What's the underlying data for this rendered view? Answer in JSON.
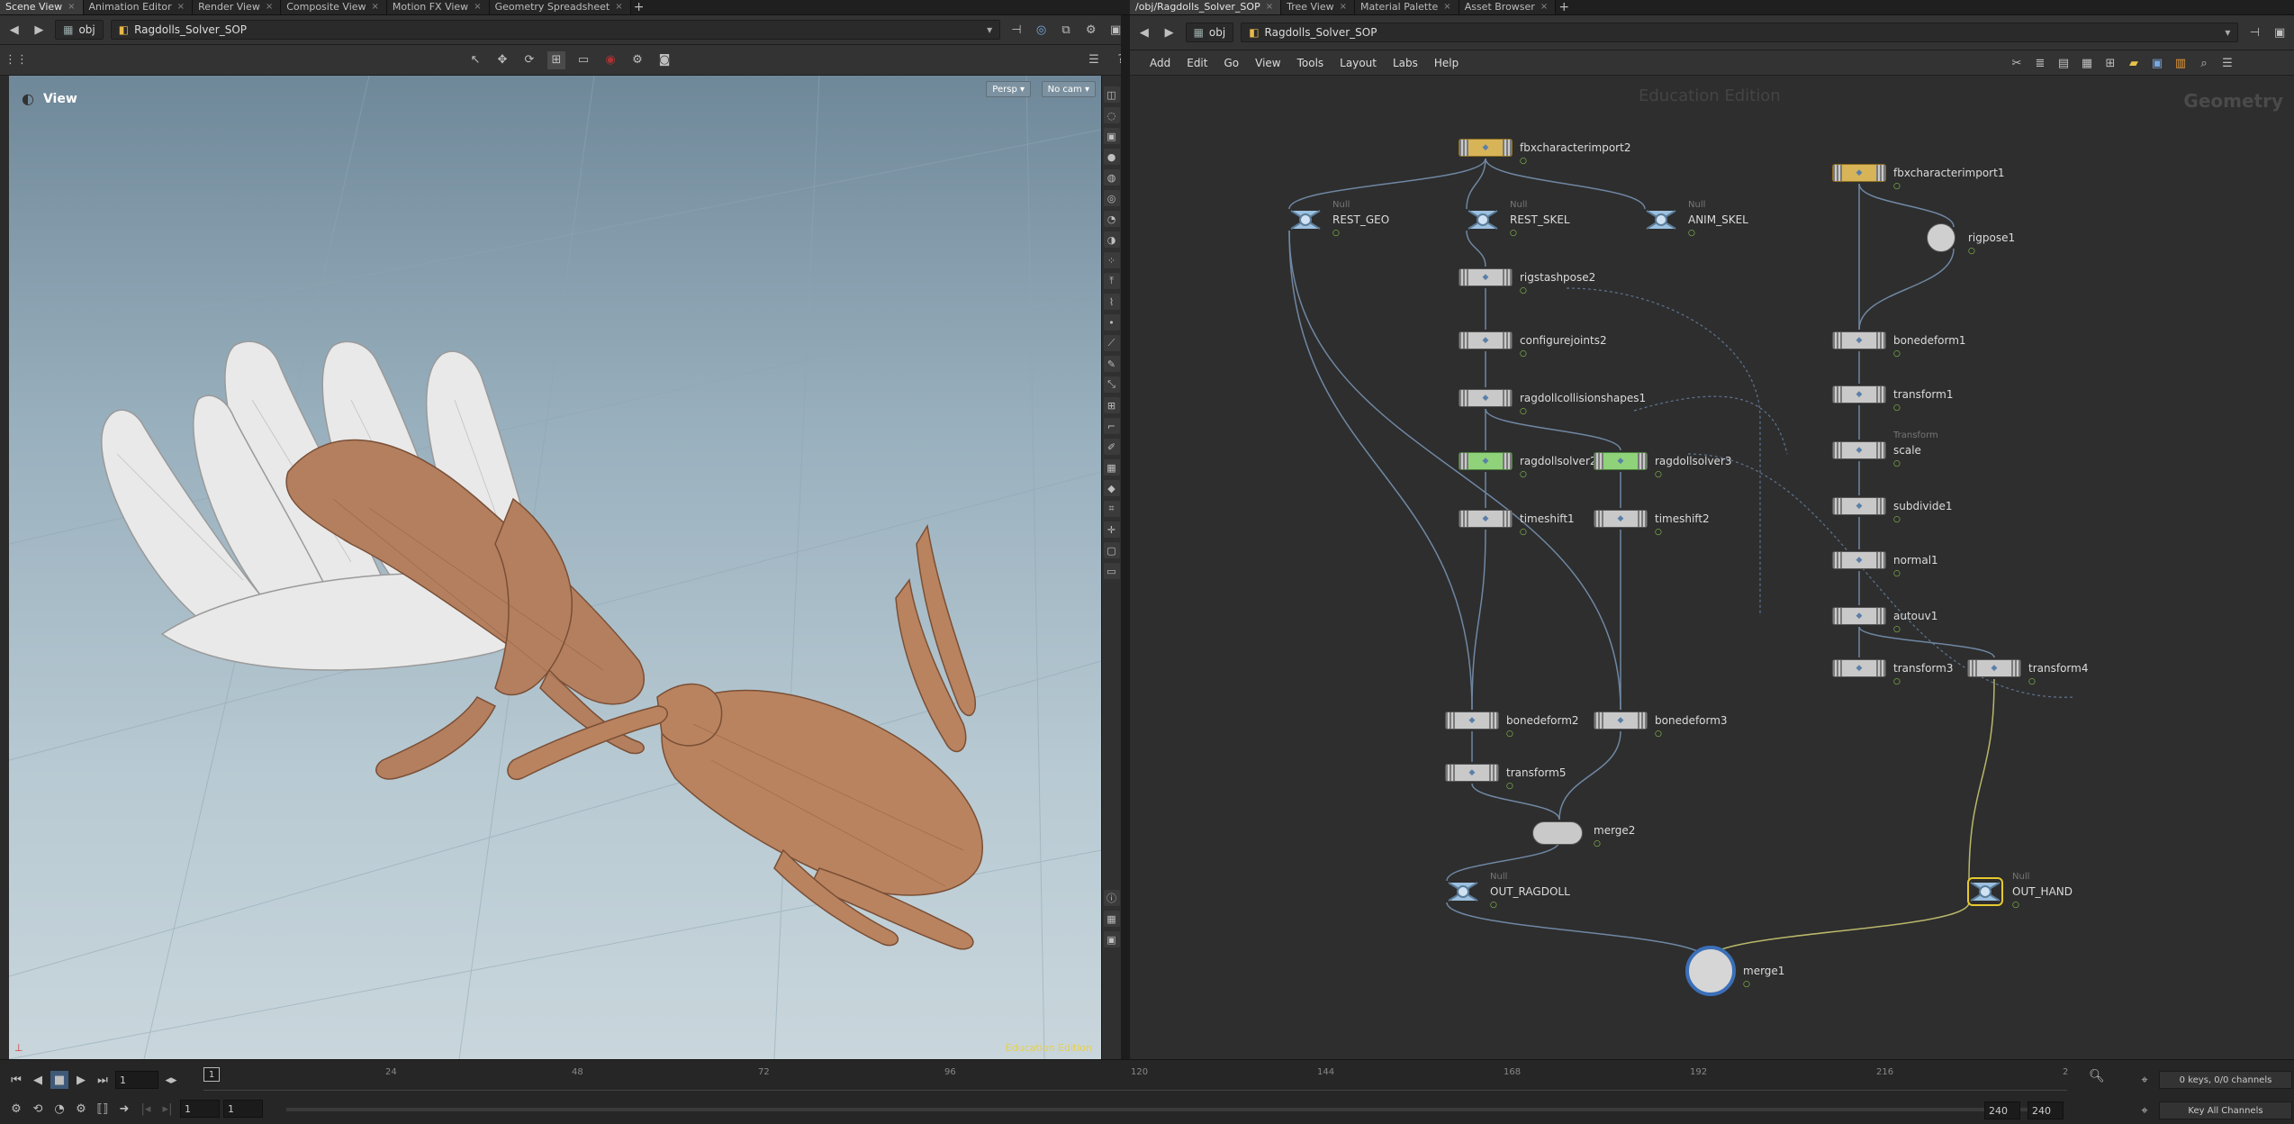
{
  "left_tabs": [
    "Scene View",
    "Animation Editor",
    "Render View",
    "Composite View",
    "Motion FX View",
    "Geometry Spreadsheet"
  ],
  "right_tabs": [
    "/obj/Ragdolls_Solver_SOP",
    "Tree View",
    "Material Palette",
    "Asset Browser"
  ],
  "left_path": {
    "root": "obj",
    "node": "Ragdolls_Solver_SOP"
  },
  "right_path": {
    "root": "obj",
    "node": "Ragdolls_Solver_SOP"
  },
  "viewport": {
    "label": "View",
    "persp": "Persp ▾",
    "cam": "No cam ▾",
    "edition": "Education Edition"
  },
  "net_menu": [
    "Add",
    "Edit",
    "Go",
    "View",
    "Tools",
    "Layout",
    "Labs",
    "Help"
  ],
  "network": {
    "watermark": "Education Edition",
    "context": "Geometry",
    "nodes": [
      {
        "id": "fbxcharacterimport2",
        "label": "fbxcharacterimport2",
        "type": "",
        "kind": "fbx"
      },
      {
        "id": "REST_GEO",
        "label": "REST_GEO",
        "type": "Null",
        "kind": "null"
      },
      {
        "id": "REST_SKEL",
        "label": "REST_SKEL",
        "type": "Null",
        "kind": "null"
      },
      {
        "id": "ANIM_SKEL",
        "label": "ANIM_SKEL",
        "type": "Null",
        "kind": "null"
      },
      {
        "id": "rigstashpose2",
        "label": "rigstashpose2",
        "type": "",
        "kind": "sop"
      },
      {
        "id": "configurejoints2",
        "label": "configurejoints2",
        "type": "",
        "kind": "sop"
      },
      {
        "id": "ragdollcollisionshapes1",
        "label": "ragdollcollisionshapes1",
        "type": "",
        "kind": "sop"
      },
      {
        "id": "ragdollsolver2",
        "label": "ragdollsolver2",
        "type": "",
        "kind": "solver"
      },
      {
        "id": "ragdollsolver3",
        "label": "ragdollsolver3",
        "type": "",
        "kind": "solver"
      },
      {
        "id": "timeshift1",
        "label": "timeshift1",
        "type": "",
        "kind": "sop"
      },
      {
        "id": "timeshift2",
        "label": "timeshift2",
        "type": "",
        "kind": "sop"
      },
      {
        "id": "bonedeform2",
        "label": "bonedeform2",
        "type": "",
        "kind": "sop"
      },
      {
        "id": "bonedeform3",
        "label": "bonedeform3",
        "type": "",
        "kind": "sop"
      },
      {
        "id": "transform5",
        "label": "transform5",
        "type": "",
        "kind": "sop"
      },
      {
        "id": "merge2",
        "label": "merge2",
        "type": "",
        "kind": "merge"
      },
      {
        "id": "OUT_RAGDOLL",
        "label": "OUT_RAGDOLL",
        "type": "Null",
        "kind": "null"
      },
      {
        "id": "merge1",
        "label": "merge1",
        "type": "",
        "kind": "mergebig"
      },
      {
        "id": "fbxcharacterimport1",
        "label": "fbxcharacterimport1",
        "type": "",
        "kind": "fbx"
      },
      {
        "id": "rigpose1",
        "label": "rigpose1",
        "type": "",
        "kind": "round"
      },
      {
        "id": "bonedeform1",
        "label": "bonedeform1",
        "type": "",
        "kind": "sop"
      },
      {
        "id": "transform1",
        "label": "transform1",
        "type": "",
        "kind": "sop"
      },
      {
        "id": "scale",
        "label": "scale",
        "type": "Transform",
        "kind": "sop"
      },
      {
        "id": "subdivide1",
        "label": "subdivide1",
        "type": "",
        "kind": "sop"
      },
      {
        "id": "normal1",
        "label": "normal1",
        "type": "",
        "kind": "sop"
      },
      {
        "id": "autouv1",
        "label": "autouv1",
        "type": "",
        "kind": "sop"
      },
      {
        "id": "transform3",
        "label": "transform3",
        "type": "",
        "kind": "sop"
      },
      {
        "id": "transform4",
        "label": "transform4",
        "type": "",
        "kind": "sop"
      },
      {
        "id": "OUT_HAND",
        "label": "OUT_HAND",
        "type": "Null",
        "kind": "null"
      }
    ]
  },
  "timeline": {
    "frame": "1",
    "ticks": [
      "24",
      "48",
      "72",
      "96",
      "120",
      "144",
      "168",
      "192",
      "216",
      "2"
    ],
    "current": "1",
    "start": "1",
    "start2": "1",
    "end": "240",
    "end2": "240",
    "keys": "0 keys, 0/0 channels",
    "keyall": "Key All Channels"
  }
}
